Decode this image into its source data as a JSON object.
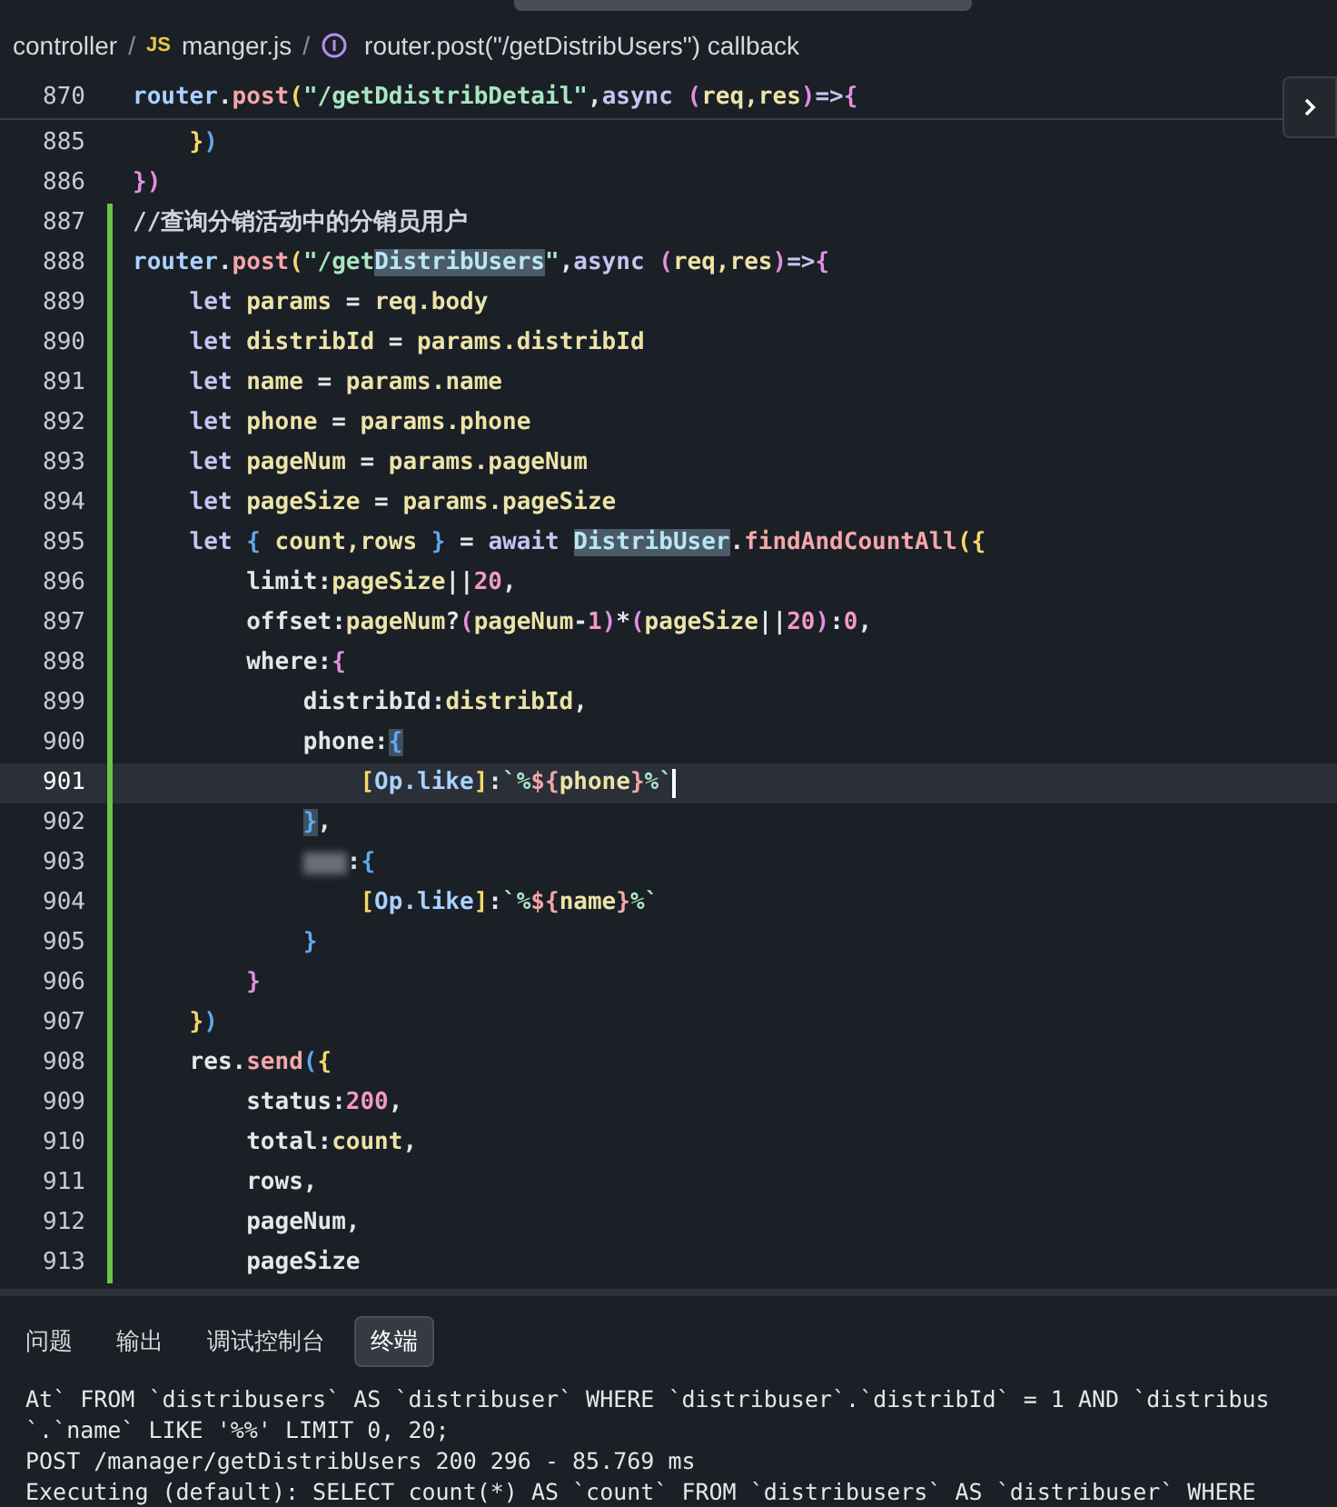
{
  "breadcrumb": [
    {
      "kind": "folder",
      "text": "controller"
    },
    {
      "kind": "sep",
      "text": "/"
    },
    {
      "kind": "file",
      "badge": "JS",
      "text": "manger.js"
    },
    {
      "kind": "sep",
      "text": "/"
    },
    {
      "kind": "symbol",
      "text": "router.post(\"/getDistribUsers\") callback"
    }
  ],
  "sticky_line": {
    "number": "870",
    "tokens": [
      {
        "kind": "obj",
        "text": "router"
      },
      {
        "kind": "plain",
        "text": "."
      },
      {
        "kind": "fn",
        "text": "post"
      },
      {
        "kind": "br1",
        "text": "("
      },
      {
        "kind": "str",
        "text": "\"/getDdistribDetail\""
      },
      {
        "kind": "plain",
        "text": ","
      },
      {
        "kind": "kw",
        "text": "async "
      },
      {
        "kind": "br2",
        "text": "("
      },
      {
        "kind": "var",
        "text": "req,res"
      },
      {
        "kind": "br2",
        "text": ")"
      },
      {
        "kind": "kw",
        "text": "=>"
      },
      {
        "kind": "br2",
        "text": "{"
      }
    ],
    "children": [
      {
        "number": "885",
        "modified": false,
        "current": false,
        "tokens": [
          {
            "kind": "br1",
            "text": "}"
          },
          {
            "kind": "br3",
            "text": ")"
          }
        ]
      }
    ]
  },
  "lines": [
    {
      "number": "886",
      "modified": false,
      "current": false,
      "tokens": [
        {
          "kind": "br2",
          "text": "})"
        }
      ]
    },
    {
      "number": "887",
      "modified": true,
      "current": false,
      "tokens": [
        {
          "kind": "comment",
          "text": "//查询分销活动中的分销员用户"
        }
      ]
    },
    {
      "number": "888",
      "modified": true,
      "current": false,
      "tokens": [
        {
          "kind": "obj",
          "text": "router"
        },
        {
          "kind": "plain",
          "text": "."
        },
        {
          "kind": "fn",
          "text": "post"
        },
        {
          "kind": "br1",
          "text": "("
        },
        {
          "kind": "str",
          "text": "\"/get"
        },
        {
          "kind": "match",
          "text": "DistribUsers"
        },
        {
          "kind": "str",
          "text": "\""
        },
        {
          "kind": "plain",
          "text": ","
        },
        {
          "kind": "kw",
          "text": "async "
        },
        {
          "kind": "br2",
          "text": "("
        },
        {
          "kind": "var",
          "text": "req,res"
        },
        {
          "kind": "br2",
          "text": ")"
        },
        {
          "kind": "kw",
          "text": "=>"
        },
        {
          "kind": "br2",
          "text": "{"
        }
      ],
      "children": [
        {
          "number": "889",
          "modified": true,
          "current": false,
          "tokens": [
            {
              "kind": "kw",
              "text": "let "
            },
            {
              "kind": "var",
              "text": "params"
            },
            {
              "kind": "plain",
              "text": " = "
            },
            {
              "kind": "var",
              "text": "req.body"
            }
          ]
        },
        {
          "number": "890",
          "modified": true,
          "current": false,
          "tokens": [
            {
              "kind": "kw",
              "text": "let "
            },
            {
              "kind": "var",
              "text": "distribId"
            },
            {
              "kind": "plain",
              "text": " = "
            },
            {
              "kind": "var",
              "text": "params.distribId"
            }
          ]
        },
        {
          "number": "891",
          "modified": true,
          "current": false,
          "tokens": [
            {
              "kind": "kw",
              "text": "let "
            },
            {
              "kind": "var",
              "text": "name"
            },
            {
              "kind": "plain",
              "text": " = "
            },
            {
              "kind": "var",
              "text": "params.name"
            }
          ]
        },
        {
          "number": "892",
          "modified": true,
          "current": false,
          "tokens": [
            {
              "kind": "kw",
              "text": "let "
            },
            {
              "kind": "var",
              "text": "phone"
            },
            {
              "kind": "plain",
              "text": " = "
            },
            {
              "kind": "var",
              "text": "params.phone"
            }
          ]
        },
        {
          "number": "893",
          "modified": true,
          "current": false,
          "tokens": [
            {
              "kind": "kw",
              "text": "let "
            },
            {
              "kind": "var",
              "text": "pageNum"
            },
            {
              "kind": "plain",
              "text": " = "
            },
            {
              "kind": "var",
              "text": "params.pageNum"
            }
          ]
        },
        {
          "number": "894",
          "modified": true,
          "current": false,
          "tokens": [
            {
              "kind": "kw",
              "text": "let "
            },
            {
              "kind": "var",
              "text": "pageSize"
            },
            {
              "kind": "plain",
              "text": " = "
            },
            {
              "kind": "var",
              "text": "params.pageSize"
            }
          ]
        },
        {
          "number": "895",
          "modified": true,
          "current": false,
          "tokens": [
            {
              "kind": "kw",
              "text": "let "
            },
            {
              "kind": "br3",
              "text": "{ "
            },
            {
              "kind": "var",
              "text": "count,rows"
            },
            {
              "kind": "br3",
              "text": " }"
            },
            {
              "kind": "plain",
              "text": " = "
            },
            {
              "kind": "kw",
              "text": "await "
            },
            {
              "kind": "match",
              "text": "DistribUser"
            },
            {
              "kind": "plain",
              "text": "."
            },
            {
              "kind": "fn",
              "text": "findAndCountAll"
            },
            {
              "kind": "br1",
              "text": "({"
            }
          ],
          "children": [
            {
              "number": "896",
              "modified": true,
              "current": false,
              "tokens": [
                {
                  "kind": "plain",
                  "text": "limit:"
                },
                {
                  "kind": "var",
                  "text": "pageSize"
                },
                {
                  "kind": "plain",
                  "text": "||"
                },
                {
                  "kind": "num",
                  "text": "20"
                },
                {
                  "kind": "plain",
                  "text": ","
                }
              ]
            },
            {
              "number": "897",
              "modified": true,
              "current": false,
              "tokens": [
                {
                  "kind": "plain",
                  "text": "offset:"
                },
                {
                  "kind": "var",
                  "text": "pageNum"
                },
                {
                  "kind": "plain",
                  "text": "?"
                },
                {
                  "kind": "br2",
                  "text": "("
                },
                {
                  "kind": "var",
                  "text": "pageNum"
                },
                {
                  "kind": "plain",
                  "text": "-"
                },
                {
                  "kind": "num",
                  "text": "1"
                },
                {
                  "kind": "br2",
                  "text": ")"
                },
                {
                  "kind": "plain",
                  "text": "*"
                },
                {
                  "kind": "br2",
                  "text": "("
                },
                {
                  "kind": "var",
                  "text": "pageSize"
                },
                {
                  "kind": "plain",
                  "text": "||"
                },
                {
                  "kind": "num",
                  "text": "20"
                },
                {
                  "kind": "br2",
                  "text": ")"
                },
                {
                  "kind": "plain",
                  "text": ":"
                },
                {
                  "kind": "num",
                  "text": "0"
                },
                {
                  "kind": "plain",
                  "text": ","
                }
              ]
            },
            {
              "number": "898",
              "modified": true,
              "current": false,
              "tokens": [
                {
                  "kind": "plain",
                  "text": "where:"
                },
                {
                  "kind": "br2",
                  "text": "{"
                }
              ],
              "children": [
                {
                  "number": "899",
                  "modified": true,
                  "current": false,
                  "tokens": [
                    {
                      "kind": "plain",
                      "text": "distribId:"
                    },
                    {
                      "kind": "var",
                      "text": "distribId"
                    },
                    {
                      "kind": "plain",
                      "text": ","
                    }
                  ]
                },
                {
                  "number": "900",
                  "modified": true,
                  "current": false,
                  "tokens": [
                    {
                      "kind": "plain",
                      "text": "phone:"
                    },
                    {
                      "kind": "bracematch",
                      "text": "{"
                    }
                  ],
                  "children": [
                    {
                      "number": "901",
                      "modified": true,
                      "current": true,
                      "tokens": [
                        {
                          "kind": "br1",
                          "text": "["
                        },
                        {
                          "kind": "obj",
                          "text": "Op.like"
                        },
                        {
                          "kind": "br1",
                          "text": "]"
                        },
                        {
                          "kind": "plain",
                          "text": ":"
                        },
                        {
                          "kind": "str",
                          "text": "`%"
                        },
                        {
                          "kind": "fn",
                          "text": "${"
                        },
                        {
                          "kind": "var",
                          "text": "phone"
                        },
                        {
                          "kind": "fn",
                          "text": "}"
                        },
                        {
                          "kind": "str",
                          "text": "%`"
                        }
                      ]
                    }
                  ]
                },
                {
                  "number": "902",
                  "modified": true,
                  "current": false,
                  "tokens": [
                    {
                      "kind": "bracematch",
                      "text": "}"
                    },
                    {
                      "kind": "plain",
                      "text": ","
                    }
                  ]
                },
                {
                  "number": "903",
                  "modified": true,
                  "current": false,
                  "tokens": [
                    {
                      "kind": "redacted"
                    },
                    {
                      "kind": "plain",
                      "text": ":"
                    },
                    {
                      "kind": "br3",
                      "text": "{"
                    }
                  ],
                  "children": [
                    {
                      "number": "904",
                      "modified": true,
                      "current": false,
                      "tokens": [
                        {
                          "kind": "br1",
                          "text": "["
                        },
                        {
                          "kind": "obj",
                          "text": "Op.like"
                        },
                        {
                          "kind": "br1",
                          "text": "]"
                        },
                        {
                          "kind": "plain",
                          "text": ":"
                        },
                        {
                          "kind": "str",
                          "text": "`%"
                        },
                        {
                          "kind": "fn",
                          "text": "${"
                        },
                        {
                          "kind": "var",
                          "text": "name"
                        },
                        {
                          "kind": "fn",
                          "text": "}"
                        },
                        {
                          "kind": "str",
                          "text": "%`"
                        }
                      ]
                    }
                  ]
                },
                {
                  "number": "905",
                  "modified": true,
                  "current": false,
                  "tokens": [
                    {
                      "kind": "br3",
                      "text": "}"
                    }
                  ]
                }
              ]
            },
            {
              "number": "906",
              "modified": true,
              "current": false,
              "tokens": [
                {
                  "kind": "br2",
                  "text": "}"
                }
              ]
            }
          ]
        },
        {
          "number": "907",
          "modified": true,
          "current": false,
          "tokens": [
            {
              "kind": "br1",
              "text": "}"
            },
            {
              "kind": "br3",
              "text": ")"
            }
          ]
        },
        {
          "number": "908",
          "modified": true,
          "current": false,
          "tokens": [
            {
              "kind": "plain",
              "text": "res."
            },
            {
              "kind": "fn",
              "text": "send"
            },
            {
              "kind": "br3",
              "text": "("
            },
            {
              "kind": "br1",
              "text": "{"
            }
          ],
          "children": [
            {
              "number": "909",
              "modified": true,
              "current": false,
              "tokens": [
                {
                  "kind": "plain",
                  "text": "status:"
                },
                {
                  "kind": "num",
                  "text": "200"
                },
                {
                  "kind": "plain",
                  "text": ","
                }
              ]
            },
            {
              "number": "910",
              "modified": true,
              "current": false,
              "tokens": [
                {
                  "kind": "plain",
                  "text": "total:"
                },
                {
                  "kind": "var",
                  "text": "count"
                },
                {
                  "kind": "plain",
                  "text": ","
                }
              ]
            },
            {
              "number": "911",
              "modified": true,
              "current": false,
              "tokens": [
                {
                  "kind": "plain",
                  "text": "rows,"
                }
              ]
            },
            {
              "number": "912",
              "modified": true,
              "current": false,
              "tokens": [
                {
                  "kind": "plain",
                  "text": "pageNum,"
                }
              ]
            },
            {
              "number": "913",
              "modified": true,
              "current": false,
              "tokens": [
                {
                  "kind": "plain",
                  "text": "pageSize"
                }
              ]
            }
          ]
        }
      ]
    }
  ],
  "panel": {
    "tabs": [
      {
        "label": "问题",
        "selected": false
      },
      {
        "label": "输出",
        "selected": false
      },
      {
        "label": "调试控制台",
        "selected": false
      },
      {
        "label": "终端",
        "selected": true
      }
    ],
    "terminal": [
      "At` FROM `distribusers` AS `distribuser` WHERE `distribuser`.`distribId` = 1 AND `distribus",
      "`.`name` LIKE '%%' LIMIT 0, 20;",
      "POST /manager/getDistribUsers 200 296 - 85.769 ms",
      "Executing (default): SELECT count(*) AS `count` FROM `distribusers` AS `distribuser` WHERE"
    ]
  }
}
